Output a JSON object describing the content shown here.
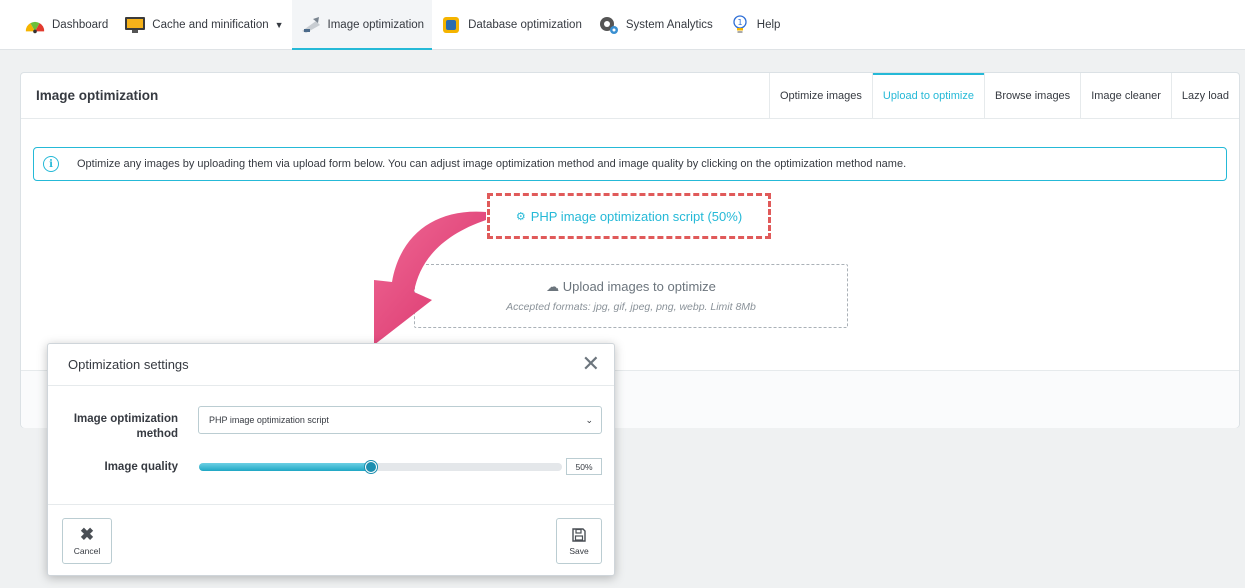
{
  "nav": {
    "items": [
      {
        "label": "Dashboard",
        "icon": "dashboard-gauge-icon"
      },
      {
        "label": "Cache and minification",
        "icon": "cache-monitor-icon",
        "dropdown": true
      },
      {
        "label": "Image optimization",
        "icon": "image-optimization-icon",
        "active": true
      },
      {
        "label": "Database optimization",
        "icon": "database-icon"
      },
      {
        "label": "System Analytics",
        "icon": "system-analytics-gears-icon"
      },
      {
        "label": "Help",
        "icon": "help-lightbulb-icon"
      }
    ]
  },
  "panel": {
    "title": "Image optimization",
    "tabs": [
      {
        "label": "Optimize images"
      },
      {
        "label": "Upload to optimize",
        "active": true
      },
      {
        "label": "Browse images"
      },
      {
        "label": "Image cleaner"
      },
      {
        "label": "Lazy load"
      }
    ],
    "info_text": "Optimize any images by uploading them via upload form below. You can adjust image optimization method and image quality by clicking on the optimization method name.",
    "method_link": "PHP image optimization script (50%)",
    "upload": {
      "title": "Upload images to optimize",
      "subtitle": "Accepted formats: jpg, gif, jpeg, png, webp. Limit 8Mb"
    }
  },
  "modal": {
    "title": "Optimization settings",
    "method_label": "Image optimization method",
    "method_value": "PHP image optimization script",
    "quality_label": "Image quality",
    "quality_value": "50%",
    "quality_fraction": 0.5,
    "cancel_label": "Cancel",
    "save_label": "Save"
  },
  "colors": {
    "accent": "#25b9d7",
    "highlight_border": "#e05a5a",
    "arrow": "#e8417a"
  }
}
